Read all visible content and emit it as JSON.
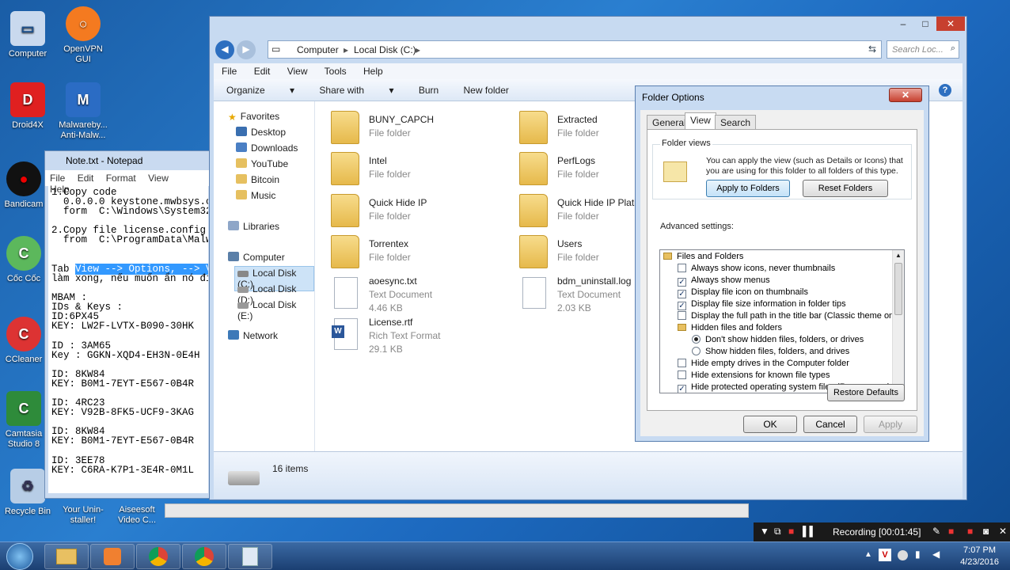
{
  "desktop": {
    "icons": [
      {
        "label": "Computer"
      },
      {
        "label": "OpenVPN GUI"
      },
      {
        "label": "Droid4X"
      },
      {
        "label": "Malwareby... Anti-Malw..."
      },
      {
        "label": "Bandicam"
      },
      {
        "label": "Cốc Cốc"
      },
      {
        "label": "CCleaner"
      },
      {
        "label": "Camtasia Studio 8"
      },
      {
        "label": "Recycle Bin"
      },
      {
        "label": "Your Unin-staller!"
      },
      {
        "label": "Aiseesoft Video C..."
      }
    ]
  },
  "notepad": {
    "title": "Note.txt - Notepad",
    "menu": [
      "File",
      "Edit",
      "Format",
      "View",
      "Help"
    ],
    "text_before": "1.Copy code\n  0.0.0.0 keystone.mwbsys.c\n  form  C:\\Windows\\System32\n\n2.Copy file license.config\n  from  C:\\ProgramData\\Malw\n\n\nTab ",
    "text_highlight": "View --> Options, --> V",
    "text_after": "\nlàm xong, nếu muốn ẩn nó đi\n\nMBAM :\nIDs & Keys :\nID:6PX45\nKEY: LW2F-LVTX-B090-30HK\n\nID : 3AM65\nKey : GGKN-XQD4-EH3N-0E4H\n\nID: 8KW84\nKEY: B0M1-7EYT-E567-0B4R\n\nID: 4RC23\nKEY: V92B-8FK5-UCF9-3KAG\n\nID: 8KW84\nKEY: B0M1-7EYT-E567-0B4R\n\nID: 3EE78\nKEY: C6RA-K7P1-3E4R-0M1L"
  },
  "explorer": {
    "address": [
      "Computer",
      "Local Disk (C:)"
    ],
    "search_placeholder": "Search Loc...",
    "menu": [
      "File",
      "Edit",
      "View",
      "Tools",
      "Help"
    ],
    "toolbar": [
      "Organize",
      "Share with",
      "Burn",
      "New folder"
    ],
    "nav": {
      "favorites": "Favorites",
      "fav_items": [
        "Desktop",
        "Downloads",
        "YouTube",
        "Bitcoin",
        "Music"
      ],
      "libraries": "Libraries",
      "computer": "Computer",
      "drives": [
        "Local Disk (C:)",
        "Local Disk (D:)",
        "Local Disk (E:)"
      ],
      "network": "Network"
    },
    "files": [
      {
        "name": "BUNY_CAPCH",
        "type": "File folder",
        "size": ""
      },
      {
        "name": "Extracted",
        "type": "File folder",
        "size": ""
      },
      {
        "name": "Intel",
        "type": "File folder",
        "size": ""
      },
      {
        "name": "PerfLogs",
        "type": "File folder",
        "size": ""
      },
      {
        "name": "Quick Hide IP",
        "type": "File folder",
        "size": ""
      },
      {
        "name": "Quick Hide IP Platin",
        "type": "File folder",
        "size": ""
      },
      {
        "name": "Torrentex",
        "type": "File folder",
        "size": ""
      },
      {
        "name": "Users",
        "type": "File folder",
        "size": ""
      },
      {
        "name": "aoesync.txt",
        "type": "Text Document",
        "size": "4.46 KB"
      },
      {
        "name": "bdm_uninstall.log",
        "type": "Text Document",
        "size": "2.03 KB"
      },
      {
        "name": "License.rtf",
        "type": "Rich Text Format",
        "size": "29.1 KB"
      }
    ],
    "status": "16 items"
  },
  "folder_options": {
    "title": "Folder Options",
    "tabs": [
      "General",
      "View",
      "Search"
    ],
    "folder_views_label": "Folder views",
    "folder_views_desc": "You can apply the view (such as Details or Icons) that you are using for this folder to all folders of this type.",
    "apply_btn": "Apply to Folders",
    "reset_btn": "Reset Folders",
    "advanced_label": "Advanced settings:",
    "settings": [
      {
        "kind": "folder",
        "label": "Files and Folders",
        "indent": 0
      },
      {
        "kind": "check",
        "checked": false,
        "label": "Always show icons, never thumbnails",
        "indent": 1
      },
      {
        "kind": "check",
        "checked": true,
        "label": "Always show menus",
        "indent": 1
      },
      {
        "kind": "check",
        "checked": true,
        "label": "Display file icon on thumbnails",
        "indent": 1
      },
      {
        "kind": "check",
        "checked": true,
        "label": "Display file size information in folder tips",
        "indent": 1
      },
      {
        "kind": "check",
        "checked": false,
        "label": "Display the full path in the title bar (Classic theme only)",
        "indent": 1
      },
      {
        "kind": "folder",
        "label": "Hidden files and folders",
        "indent": 1
      },
      {
        "kind": "radio",
        "checked": true,
        "label": "Don't show hidden files, folders, or drives",
        "indent": 2
      },
      {
        "kind": "radio",
        "checked": false,
        "label": "Show hidden files, folders, and drives",
        "indent": 2
      },
      {
        "kind": "check",
        "checked": false,
        "label": "Hide empty drives in the Computer folder",
        "indent": 1
      },
      {
        "kind": "check",
        "checked": false,
        "label": "Hide extensions for known file types",
        "indent": 1
      },
      {
        "kind": "check",
        "checked": true,
        "label": "Hide protected operating system files (Recommended)",
        "indent": 1
      }
    ],
    "restore_btn": "Restore Defaults",
    "ok": "OK",
    "cancel": "Cancel",
    "apply": "Apply"
  },
  "recording": {
    "label": "Recording [00:01:45]"
  },
  "taskbar": {
    "time": "7:07 PM",
    "date": "4/23/2016"
  }
}
